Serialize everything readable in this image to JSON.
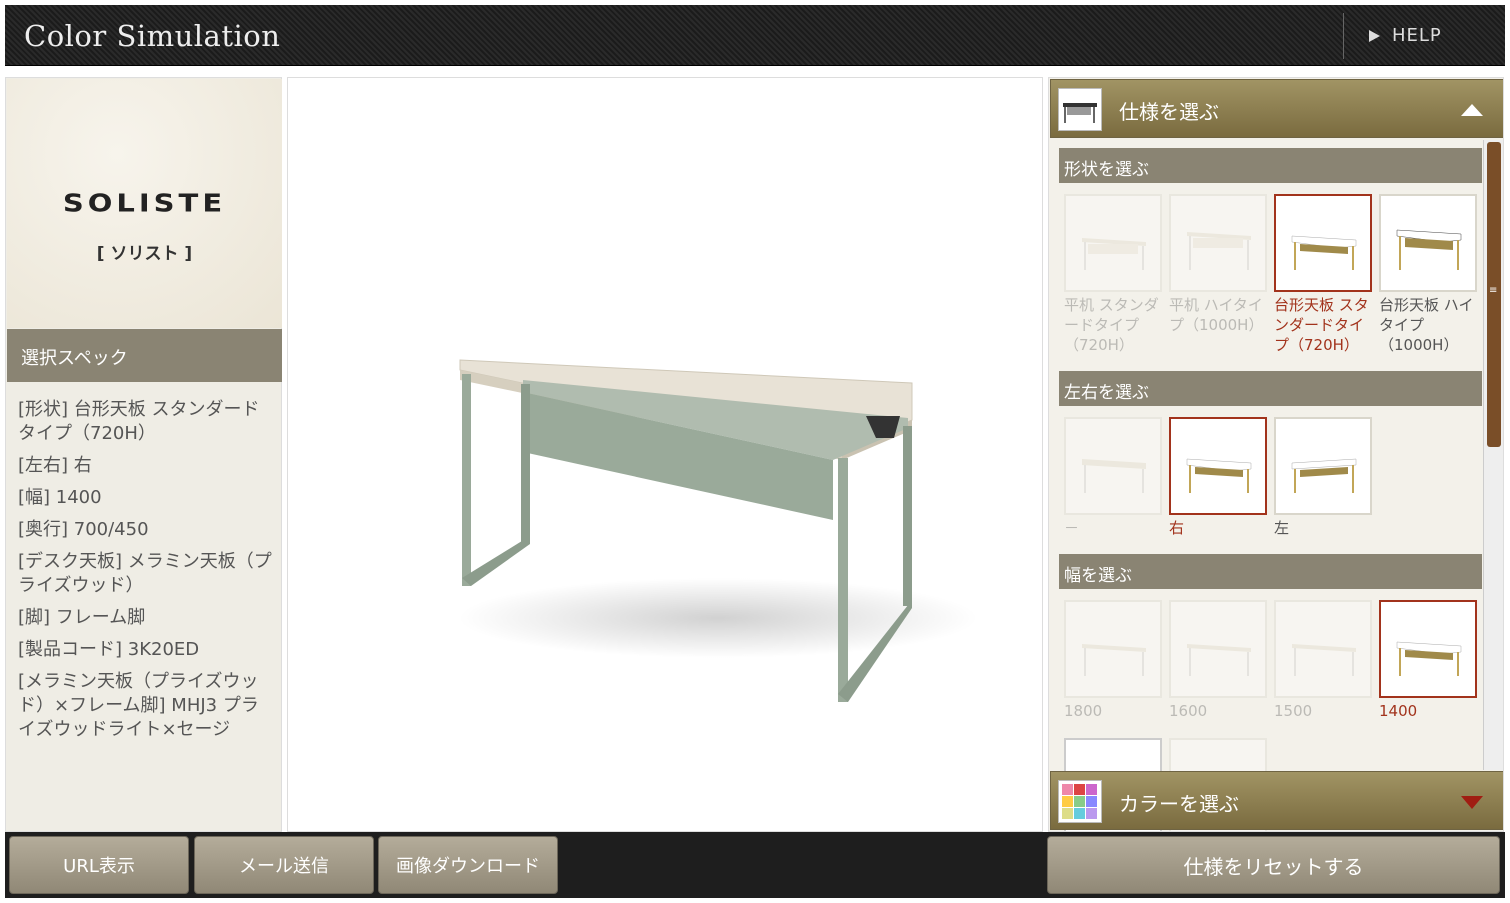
{
  "app": {
    "title": "Color Simulation",
    "help": "HELP"
  },
  "brand": {
    "logo": "SOLISTE",
    "kana": "[ ソリスト ]"
  },
  "spec": {
    "heading": "選択スペック",
    "items": [
      "[形状] 台形天板 スタンダードタイプ（720H）",
      "[左右] 右",
      "[幅] 1400",
      "[奥行] 700/450",
      "[デスク天板] メラミン天板（プライズウッド）",
      "[脚] フレーム脚",
      "[製品コード] 3K20ED",
      "[メラミン天板（プライズウッド）×フレーム脚] MHJ3 プライズウッドライト×セージ"
    ]
  },
  "panel": {
    "spec_accordion": "仕様を選ぶ",
    "color_accordion": "カラーを選ぶ",
    "shape": {
      "heading": "形状を選ぶ",
      "options": [
        {
          "label": "平机 スタンダードタイプ（720H）",
          "state": "disabled"
        },
        {
          "label": "平机 ハイタイプ（1000H）",
          "state": "disabled"
        },
        {
          "label": "台形天板 スタンダードタイプ（720H）",
          "state": "selected"
        },
        {
          "label": "台形天板 ハイタイプ（1000H）",
          "state": "normal"
        }
      ]
    },
    "side": {
      "heading": "左右を選ぶ",
      "options": [
        {
          "label": "－",
          "state": "disabled"
        },
        {
          "label": "右",
          "state": "selected"
        },
        {
          "label": "左",
          "state": "normal"
        }
      ]
    },
    "width": {
      "heading": "幅を選ぶ",
      "options": [
        {
          "label": "1800",
          "state": "disabled"
        },
        {
          "label": "1600",
          "state": "disabled"
        },
        {
          "label": "1500",
          "state": "disabled"
        },
        {
          "label": "1400",
          "state": "selected"
        }
      ]
    }
  },
  "buttons": {
    "url": "URL表示",
    "mail": "メール送信",
    "download": "画像ダウンロード",
    "reset": "仕様をリセットする"
  },
  "colors": {
    "accent": "#a2331c",
    "gold": "#8c7d4e",
    "frame": "#9aaa9a",
    "top": "#e8e2d6"
  }
}
